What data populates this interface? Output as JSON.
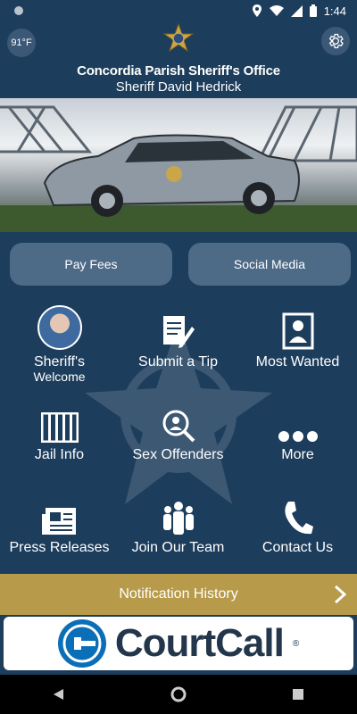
{
  "status_bar": {
    "time": "1:44"
  },
  "header": {
    "weather": "91°F",
    "title": "Concordia Parish Sheriff's Office",
    "subtitle": "Sheriff David Hedrick"
  },
  "actions": {
    "pay_fees": "Pay Fees",
    "social_media": "Social Media"
  },
  "tiles": [
    {
      "label_line1": "Sheriff's",
      "label_line2": "Welcome"
    },
    {
      "label": "Submit a Tip"
    },
    {
      "label": "Most Wanted"
    },
    {
      "label": "Jail Info"
    },
    {
      "label": "Sex Offenders"
    },
    {
      "label": "More"
    },
    {
      "label": "Press Releases"
    },
    {
      "label": "Join Our Team"
    },
    {
      "label": "Contact Us"
    }
  ],
  "notification_bar": {
    "label": "Notification History"
  },
  "banner": {
    "brand": "CourtCall",
    "registered": "®"
  },
  "colors": {
    "background": "#1d3d5c",
    "pill": "#4d6a87",
    "notification": "#b79a4a"
  },
  "icons": [
    "settings-gear-icon",
    "sheriff-star-badge-icon",
    "document-pen-icon",
    "wanted-person-icon",
    "jail-bars-icon",
    "magnifier-person-icon",
    "more-dots-icon",
    "newspaper-icon",
    "group-people-icon",
    "phone-icon",
    "chevron-right-icon"
  ]
}
